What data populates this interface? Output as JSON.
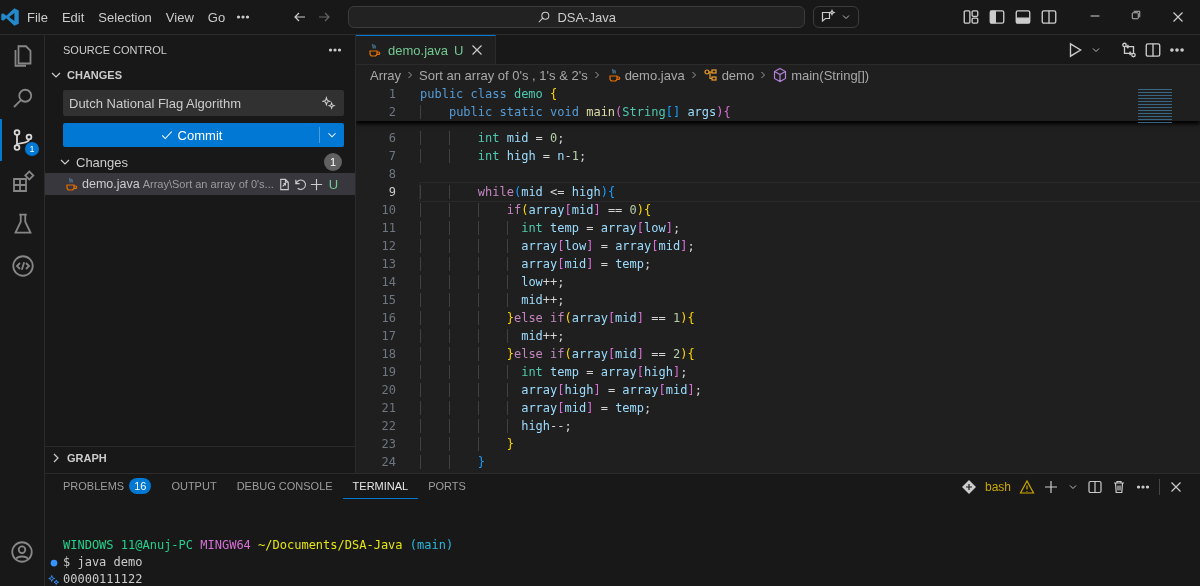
{
  "titlebar": {
    "menu": [
      "File",
      "Edit",
      "Selection",
      "View",
      "Go"
    ],
    "command_center": "DSA-Java"
  },
  "activity_bar": {
    "items": [
      {
        "kind": "explorer",
        "selected": false
      },
      {
        "kind": "search",
        "selected": false
      },
      {
        "kind": "source_control",
        "selected": true,
        "badge": "1"
      },
      {
        "kind": "extensions",
        "selected": false
      },
      {
        "kind": "testing",
        "selected": false
      },
      {
        "kind": "remote",
        "selected": false
      }
    ]
  },
  "sidebar": {
    "title": "SOURCE CONTROL",
    "section": {
      "title": "CHANGES",
      "expanded": true
    },
    "commit_message": {
      "value": "Dutch National Flag Algorithm"
    },
    "commit_button": "Commit",
    "group": {
      "title": "Changes",
      "expanded": true,
      "count": "1"
    },
    "files": [
      {
        "name": "demo.java",
        "path": "Array\\Sort an array of 0's...",
        "status": "U",
        "selected": true
      }
    ],
    "graph": {
      "title": "GRAPH",
      "expanded": false
    }
  },
  "editor": {
    "tabs": [
      {
        "name": "demo.java",
        "status": "U",
        "selected": true
      }
    ],
    "breadcrumb": [
      {
        "kind": "folder",
        "text": "Array"
      },
      {
        "kind": "folder",
        "text": "Sort an array of 0's , 1's & 2's"
      },
      {
        "kind": "file",
        "text": "demo.java"
      },
      {
        "kind": "class",
        "text": "demo"
      },
      {
        "kind": "method",
        "text": "main(String[])"
      }
    ],
    "sticky_lines": [
      {
        "number": "1",
        "current": false,
        "tokens": [
          {
            "text": "public class ",
            "kind": "kw"
          },
          {
            "text": "demo ",
            "kind": "type"
          },
          {
            "text": "{",
            "kind": "b1"
          }
        ]
      },
      {
        "number": "2",
        "current": false,
        "tokens": [
          {
            "text": "    public static void ",
            "kind": "kw"
          },
          {
            "text": "main",
            "kind": "fn"
          },
          {
            "text": "(",
            "kind": "b2"
          },
          {
            "text": "String",
            "kind": "type"
          },
          {
            "text": "[] ",
            "kind": "b3"
          },
          {
            "text": "args",
            "kind": "var"
          },
          {
            "text": "){",
            "kind": "b2"
          }
        ]
      }
    ],
    "lines": [
      {
        "number": "6",
        "current": false,
        "tokens": [
          {
            "text": "        int ",
            "kind": "type"
          },
          {
            "text": "mid",
            "kind": "var"
          },
          {
            "text": " = ",
            "kind": "op"
          },
          {
            "text": "0",
            "kind": "num"
          },
          {
            "text": ";",
            "kind": "op"
          }
        ]
      },
      {
        "number": "7",
        "current": false,
        "tokens": [
          {
            "text": "        int ",
            "kind": "type"
          },
          {
            "text": "high",
            "kind": "var"
          },
          {
            "text": " = ",
            "kind": "op"
          },
          {
            "text": "n",
            "kind": "var"
          },
          {
            "text": "-",
            "kind": "op"
          },
          {
            "text": "1",
            "kind": "num"
          },
          {
            "text": ";",
            "kind": "op"
          }
        ]
      },
      {
        "number": "8",
        "current": false
      },
      {
        "number": "9",
        "current": true,
        "tokens": [
          {
            "text": "        while",
            "kind": "ctrl"
          },
          {
            "text": "(",
            "kind": "b3"
          },
          {
            "text": "mid",
            "kind": "var"
          },
          {
            "text": " <= ",
            "kind": "op"
          },
          {
            "text": "high",
            "kind": "var"
          },
          {
            "text": "){",
            "kind": "b3"
          }
        ]
      },
      {
        "number": "10",
        "current": false,
        "tokens": [
          {
            "text": "            if",
            "kind": "ctrl"
          },
          {
            "text": "(",
            "kind": "b1"
          },
          {
            "text": "array",
            "kind": "var"
          },
          {
            "text": "[",
            "kind": "b2"
          },
          {
            "text": "mid",
            "kind": "var"
          },
          {
            "text": "]",
            "kind": "b2"
          },
          {
            "text": " == ",
            "kind": "op"
          },
          {
            "text": "0",
            "kind": "num"
          },
          {
            "text": "){",
            "kind": "b1"
          }
        ]
      },
      {
        "number": "11",
        "current": false,
        "tokens": [
          {
            "text": "              int ",
            "kind": "type"
          },
          {
            "text": "temp",
            "kind": "var"
          },
          {
            "text": " = ",
            "kind": "op"
          },
          {
            "text": "array",
            "kind": "var"
          },
          {
            "text": "[",
            "kind": "b2"
          },
          {
            "text": "low",
            "kind": "var"
          },
          {
            "text": "]",
            "kind": "b2"
          },
          {
            "text": ";",
            "kind": "op"
          }
        ]
      },
      {
        "number": "12",
        "current": false,
        "tokens": [
          {
            "text": "              array",
            "kind": "var"
          },
          {
            "text": "[",
            "kind": "b2"
          },
          {
            "text": "low",
            "kind": "var"
          },
          {
            "text": "]",
            "kind": "b2"
          },
          {
            "text": " = ",
            "kind": "op"
          },
          {
            "text": "array",
            "kind": "var"
          },
          {
            "text": "[",
            "kind": "b2"
          },
          {
            "text": "mid",
            "kind": "var"
          },
          {
            "text": "]",
            "kind": "b2"
          },
          {
            "text": ";",
            "kind": "op"
          }
        ]
      },
      {
        "number": "13",
        "current": false,
        "tokens": [
          {
            "text": "              array",
            "kind": "var"
          },
          {
            "text": "[",
            "kind": "b2"
          },
          {
            "text": "mid",
            "kind": "var"
          },
          {
            "text": "]",
            "kind": "b2"
          },
          {
            "text": " = ",
            "kind": "op"
          },
          {
            "text": "temp",
            "kind": "var"
          },
          {
            "text": ";",
            "kind": "op"
          }
        ]
      },
      {
        "number": "14",
        "current": false,
        "tokens": [
          {
            "text": "              low",
            "kind": "var"
          },
          {
            "text": "++;",
            "kind": "op"
          }
        ]
      },
      {
        "number": "15",
        "current": false,
        "tokens": [
          {
            "text": "              mid",
            "kind": "var"
          },
          {
            "text": "++;",
            "kind": "op"
          }
        ]
      },
      {
        "number": "16",
        "current": false,
        "tokens": [
          {
            "text": "            }",
            "kind": "b1"
          },
          {
            "text": "else if",
            "kind": "ctrl"
          },
          {
            "text": "(",
            "kind": "b1"
          },
          {
            "text": "array",
            "kind": "var"
          },
          {
            "text": "[",
            "kind": "b2"
          },
          {
            "text": "mid",
            "kind": "var"
          },
          {
            "text": "]",
            "kind": "b2"
          },
          {
            "text": " == ",
            "kind": "op"
          },
          {
            "text": "1",
            "kind": "num"
          },
          {
            "text": "){",
            "kind": "b1"
          }
        ]
      },
      {
        "number": "17",
        "current": false,
        "tokens": [
          {
            "text": "              mid",
            "kind": "var"
          },
          {
            "text": "++;",
            "kind": "op"
          }
        ]
      },
      {
        "number": "18",
        "current": false,
        "tokens": [
          {
            "text": "            }",
            "kind": "b1"
          },
          {
            "text": "else if",
            "kind": "ctrl"
          },
          {
            "text": "(",
            "kind": "b1"
          },
          {
            "text": "array",
            "kind": "var"
          },
          {
            "text": "[",
            "kind": "b2"
          },
          {
            "text": "mid",
            "kind": "var"
          },
          {
            "text": "]",
            "kind": "b2"
          },
          {
            "text": " == ",
            "kind": "op"
          },
          {
            "text": "2",
            "kind": "num"
          },
          {
            "text": "){",
            "kind": "b1"
          }
        ]
      },
      {
        "number": "19",
        "current": false,
        "tokens": [
          {
            "text": "              int ",
            "kind": "type"
          },
          {
            "text": "temp",
            "kind": "var"
          },
          {
            "text": " = ",
            "kind": "op"
          },
          {
            "text": "array",
            "kind": "var"
          },
          {
            "text": "[",
            "kind": "b2"
          },
          {
            "text": "high",
            "kind": "var"
          },
          {
            "text": "]",
            "kind": "b2"
          },
          {
            "text": ";",
            "kind": "op"
          }
        ]
      },
      {
        "number": "20",
        "current": false,
        "tokens": [
          {
            "text": "              array",
            "kind": "var"
          },
          {
            "text": "[",
            "kind": "b2"
          },
          {
            "text": "high",
            "kind": "var"
          },
          {
            "text": "]",
            "kind": "b2"
          },
          {
            "text": " = ",
            "kind": "op"
          },
          {
            "text": "array",
            "kind": "var"
          },
          {
            "text": "[",
            "kind": "b2"
          },
          {
            "text": "mid",
            "kind": "var"
          },
          {
            "text": "]",
            "kind": "b2"
          },
          {
            "text": ";",
            "kind": "op"
          }
        ]
      },
      {
        "number": "21",
        "current": false,
        "tokens": [
          {
            "text": "              array",
            "kind": "var"
          },
          {
            "text": "[",
            "kind": "b2"
          },
          {
            "text": "mid",
            "kind": "var"
          },
          {
            "text": "]",
            "kind": "b2"
          },
          {
            "text": " = ",
            "kind": "op"
          },
          {
            "text": "temp",
            "kind": "var"
          },
          {
            "text": ";",
            "kind": "op"
          }
        ]
      },
      {
        "number": "22",
        "current": false,
        "tokens": [
          {
            "text": "              high",
            "kind": "var"
          },
          {
            "text": "--;",
            "kind": "op"
          }
        ]
      },
      {
        "number": "23",
        "current": false,
        "tokens": [
          {
            "text": "            }",
            "kind": "b1"
          }
        ]
      },
      {
        "number": "24",
        "current": false,
        "tokens": [
          {
            "text": "        }",
            "kind": "b3"
          }
        ]
      }
    ]
  },
  "panel": {
    "tabs": [
      {
        "label": "PROBLEMS",
        "badge": "16",
        "selected": false
      },
      {
        "label": "OUTPUT",
        "selected": false
      },
      {
        "label": "DEBUG CONSOLE",
        "selected": false
      },
      {
        "label": "TERMINAL",
        "selected": true
      },
      {
        "label": "PORTS",
        "selected": false
      }
    ],
    "shell": "bash",
    "terminal": [
      {
        "kind": "prompt",
        "segments": [
          {
            "text": "WINDOWS 11@Anuj-PC",
            "kind": "user"
          },
          {
            "text": "MINGW64",
            "kind": "host"
          },
          {
            "text": "~/Documents/DSA-Java",
            "kind": "path"
          },
          {
            "text": "(main)",
            "kind": "branch"
          }
        ]
      },
      {
        "kind": "command",
        "text": "$ java demo"
      },
      {
        "kind": "output",
        "text": "00000111122"
      }
    ]
  }
}
